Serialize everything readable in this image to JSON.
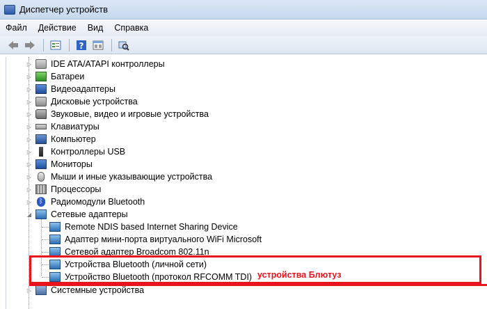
{
  "window": {
    "title": "Диспетчер устройств"
  },
  "menu": {
    "file": "Файл",
    "action": "Действие",
    "view": "Вид",
    "help": "Справка"
  },
  "toolbar": {
    "buttons": [
      "back-icon",
      "forward-icon",
      "properties-icon",
      "help-icon",
      "view-icon",
      "scan-hardware-icon"
    ]
  },
  "tree": {
    "categories": [
      {
        "label": "IDE ATA/ATAPI контроллеры",
        "icon": "drive-icon"
      },
      {
        "label": "Батареи",
        "icon": "battery-icon"
      },
      {
        "label": "Видеоадаптеры",
        "icon": "display-adapter-icon"
      },
      {
        "label": "Дисковые устройства",
        "icon": "disk-icon"
      },
      {
        "label": "Звуковые, видео и игровые устройства",
        "icon": "speaker-icon"
      },
      {
        "label": "Клавиатуры",
        "icon": "keyboard-icon"
      },
      {
        "label": "Компьютер",
        "icon": "computer-icon"
      },
      {
        "label": "Контроллеры USB",
        "icon": "usb-icon"
      },
      {
        "label": "Мониторы",
        "icon": "monitor-icon"
      },
      {
        "label": "Мыши и иные указывающие устройства",
        "icon": "mouse-icon"
      },
      {
        "label": "Процессоры",
        "icon": "cpu-icon"
      },
      {
        "label": "Радиомодули Bluetooth",
        "icon": "bluetooth-icon"
      },
      {
        "label": "Сетевые адаптеры",
        "icon": "network-adapter-icon"
      }
    ],
    "network_children": [
      {
        "label": "Remote NDIS based Internet Sharing Device"
      },
      {
        "label": "Адаптер мини-порта виртуального WiFi Microsoft"
      },
      {
        "label": "Сетевой адаптер Broadcom 802.11n"
      },
      {
        "label": "Устройства Bluetooth (личной сети)"
      },
      {
        "label": "Устройство Bluetooth (протокол RFCOMM TDI)"
      }
    ],
    "last_category": {
      "label": "Системные устройства",
      "icon": "system-devices-icon"
    }
  },
  "annotation": {
    "text": "устройства Блютуз",
    "color": "#e8131c"
  }
}
